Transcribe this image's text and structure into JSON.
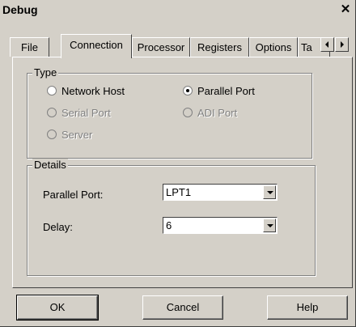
{
  "window": {
    "title": "Debug",
    "close_glyph": "✕"
  },
  "tabs": [
    {
      "label": "File"
    },
    {
      "label": "Connection",
      "active": true
    },
    {
      "label": "Processor"
    },
    {
      "label": "Registers"
    },
    {
      "label": "Options"
    },
    {
      "label": "Ta"
    }
  ],
  "tab_scroll": {
    "left_icon": "scroll-left-icon",
    "right_icon": "scroll-right-icon"
  },
  "type_group": {
    "title": "Type",
    "options": [
      {
        "label": "Network Host",
        "selected": false,
        "enabled": true
      },
      {
        "label": "Parallel Port",
        "selected": true,
        "enabled": true
      },
      {
        "label": "Serial Port",
        "selected": false,
        "enabled": false
      },
      {
        "label": "ADI Port",
        "selected": false,
        "enabled": false
      },
      {
        "label": "Server",
        "selected": false,
        "enabled": false
      }
    ]
  },
  "details_group": {
    "title": "Details",
    "parallel_port": {
      "label": "Parallel Port:",
      "value": "LPT1"
    },
    "delay": {
      "label": "Delay:",
      "value": "6"
    }
  },
  "buttons": {
    "ok": "OK",
    "cancel": "Cancel",
    "help": "Help"
  }
}
